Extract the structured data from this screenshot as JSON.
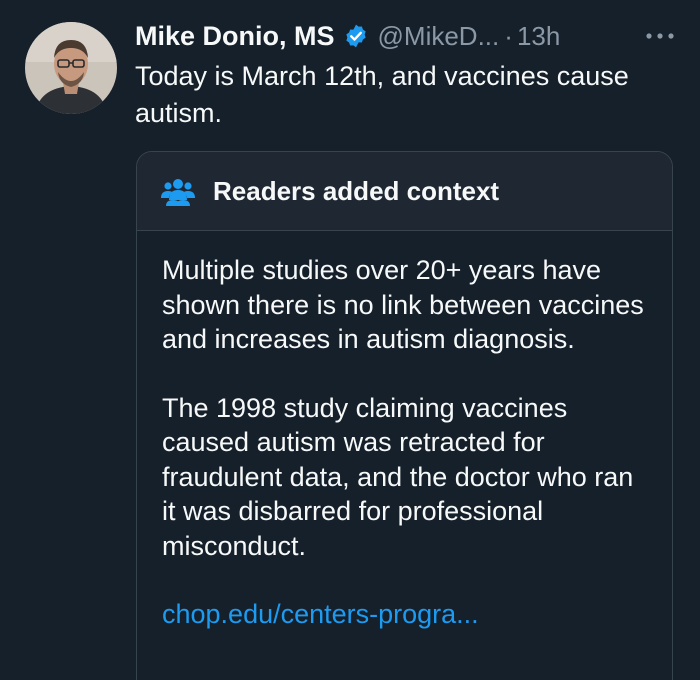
{
  "author": {
    "display_name": "Mike Donio, MS",
    "handle": "@MikeD...",
    "separator": "·",
    "time": "13h"
  },
  "tweet": {
    "text": "Today is March 12th, and vaccines cause autism."
  },
  "community_note": {
    "title": "Readers added context",
    "paragraphs": [
      "Multiple studies over 20+ years have shown there is no link between vaccines and increases in autism diagnosis.",
      "The 1998 study claiming vaccines caused autism was retracted for fraudulent data, and the doctor who ran it was disbarred for professional misconduct."
    ],
    "link": "chop.edu/centers-progra..."
  },
  "colors": {
    "background": "#15202b",
    "card_header": "#1e2732",
    "border": "#38444d",
    "text_primary": "#f7f9f9",
    "text_secondary": "#8b98a5",
    "accent": "#1d9bf0"
  },
  "icons": {
    "verified": "verified-badge-icon",
    "more": "more-options-icon",
    "note": "people-group-icon"
  }
}
